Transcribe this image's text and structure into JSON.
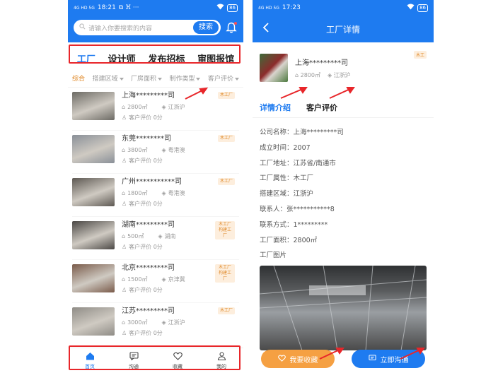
{
  "colors": {
    "brand_blue": "#1e7bf0",
    "annotation_red": "#e8262a",
    "tag_orange": "#e08a2a",
    "collect_orange": "#f5a042"
  },
  "left": {
    "status": {
      "time": "18:21",
      "signal": "4G HD 5G",
      "battery": "86",
      "extra": "⧉ ⴼ ···"
    },
    "search": {
      "placeholder": "请输入你要搜索的内容",
      "button": "搜索"
    },
    "tabs": [
      {
        "label": "工厂",
        "active": true
      },
      {
        "label": "设计师",
        "active": false
      },
      {
        "label": "发布招标",
        "active": false
      },
      {
        "label": "审图报馆",
        "active": false
      }
    ],
    "filters": [
      "综合",
      "搭建区域",
      "厂房面积",
      "制作类型",
      "客户评价"
    ],
    "items": [
      {
        "name": "上海*********司",
        "area": "2800㎡",
        "region": "江浙沪",
        "rating": "客户评价 0分",
        "tag": "木工厂",
        "photo": "#6c6a64"
      },
      {
        "name": "东莞********司",
        "area": "3800㎡",
        "region": "粤港澳",
        "rating": "客户评价 0分",
        "tag": "木工厂",
        "photo": "#8a9098"
      },
      {
        "name": "广州***********司",
        "area": "1800㎡",
        "region": "粤港澳",
        "rating": "客户评价 0分",
        "tag": "木工厂",
        "photo": "#5d5852"
      },
      {
        "name": "湖南*********司",
        "area": "500㎡",
        "region": "湖南",
        "rating": "客户评价 0分",
        "tag": "木工厂 构建工厂",
        "photo": "#4a4744"
      },
      {
        "name": "北京*********司",
        "area": "1500㎡",
        "region": "京津冀",
        "rating": "客户评价 0分",
        "tag": "木工厂 构建工厂",
        "photo": "#7a5b4a"
      },
      {
        "name": "江苏*********司",
        "area": "3000㎡",
        "region": "江浙沪",
        "rating": "客户评价 0分",
        "tag": "木工厂",
        "photo": "#8f8c86"
      }
    ],
    "tabbar": [
      {
        "label": "首页",
        "icon": "home-icon",
        "active": true
      },
      {
        "label": "沟通",
        "icon": "chat-icon",
        "active": false
      },
      {
        "label": "收藏",
        "icon": "heart-icon",
        "active": false
      },
      {
        "label": "我的",
        "icon": "user-icon",
        "active": false
      }
    ]
  },
  "right": {
    "status": {
      "time": "17:23",
      "signal": "4G HD 5G",
      "battery": "86"
    },
    "nav_title": "工厂详情",
    "card": {
      "name": "上海*********司",
      "area": "2800㎡",
      "region": "江浙沪",
      "tag": "木工"
    },
    "tabs": [
      {
        "label": "详情介绍",
        "active": true
      },
      {
        "label": "客户评价",
        "active": false
      }
    ],
    "details": [
      "公司名称：上海*********司",
      "成立时间：2007",
      "工厂地址：江苏省/南通市",
      "工厂属性：木工厂",
      "搭建区域：江浙沪",
      "联系人：张***********8",
      "联系方式：1*********",
      "工厂面积：2800㎡",
      "工厂图片"
    ],
    "buttons": {
      "collect": "我要收藏",
      "contact": "立即沟通"
    }
  }
}
